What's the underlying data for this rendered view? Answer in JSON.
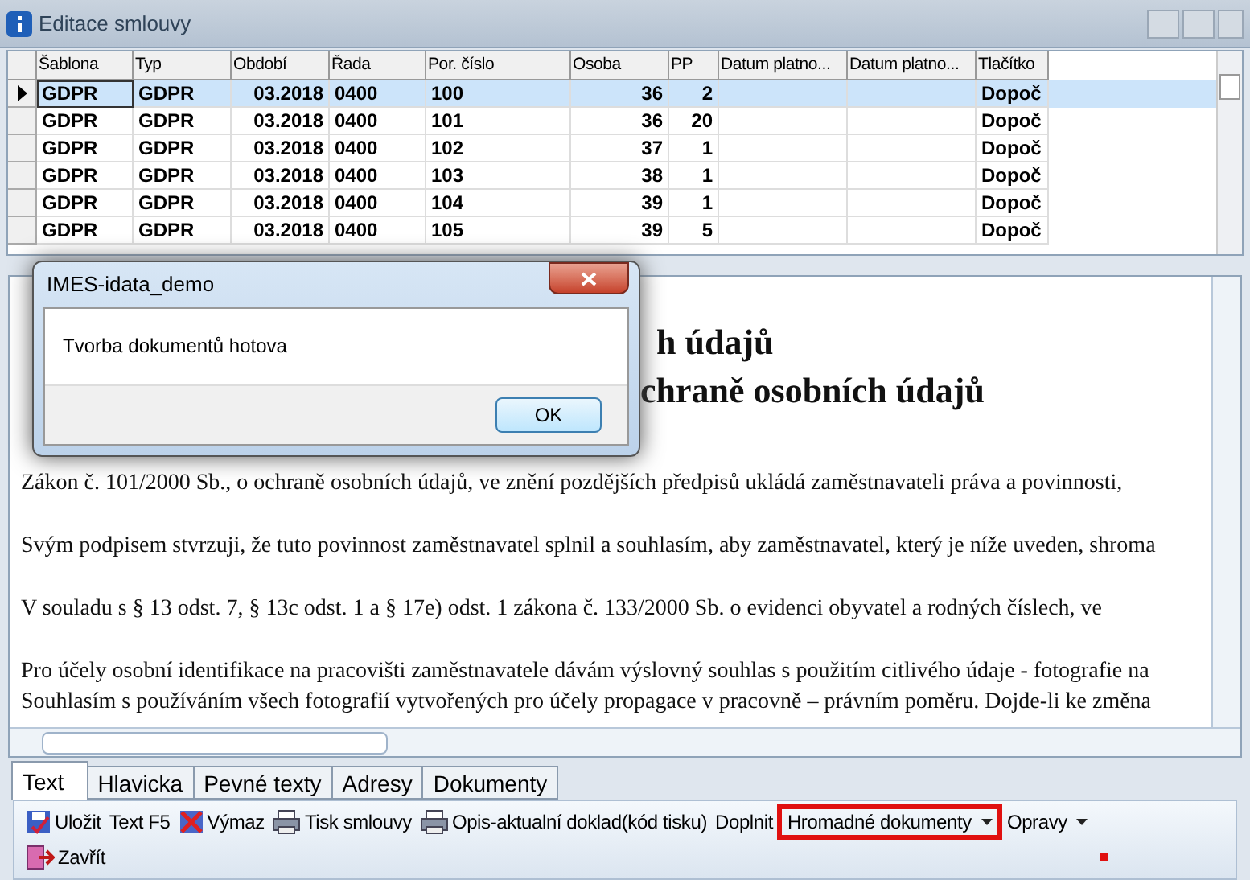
{
  "window": {
    "title": "Editace smlouvy"
  },
  "grid": {
    "columns": [
      "Šablona",
      "Typ",
      "Období",
      "Řada",
      "Por. číslo",
      "Osoba",
      "PP",
      "Datum platno...",
      "Datum platno...",
      "Tlačítko"
    ],
    "rows": [
      {
        "selected": true,
        "cells": [
          "GDPR",
          "GDPR",
          "03.2018",
          "0400",
          "100",
          "36",
          "2",
          "",
          "",
          "Dopoč"
        ]
      },
      {
        "selected": false,
        "cells": [
          "GDPR",
          "GDPR",
          "03.2018",
          "0400",
          "101",
          "36",
          "20",
          "",
          "",
          "Dopoč"
        ]
      },
      {
        "selected": false,
        "cells": [
          "GDPR",
          "GDPR",
          "03.2018",
          "0400",
          "102",
          "37",
          "1",
          "",
          "",
          "Dopoč"
        ]
      },
      {
        "selected": false,
        "cells": [
          "GDPR",
          "GDPR",
          "03.2018",
          "0400",
          "103",
          "38",
          "1",
          "",
          "",
          "Dopoč"
        ]
      },
      {
        "selected": false,
        "cells": [
          "GDPR",
          "GDPR",
          "03.2018",
          "0400",
          "104",
          "39",
          "1",
          "",
          "",
          "Dopoč"
        ]
      },
      {
        "selected": false,
        "cells": [
          "GDPR",
          "GDPR",
          "03.2018",
          "0400",
          "105",
          "39",
          "5",
          "",
          "",
          "Dopoč"
        ]
      }
    ]
  },
  "document": {
    "headings": [
      "h údajů",
      "chraně osobních údajů"
    ],
    "paragraphs": [
      [
        "Zákon č. 101/2000 Sb., o ochraně osobních údajů, ve znění pozdějších předpisů ukládá zaměstnavateli práva a povinnosti,"
      ],
      [
        "Svým podpisem stvrzuji, že tuto povinnost zaměstnavatel splnil a souhlasím, aby zaměstnavatel, který je níže uveden, shroma"
      ],
      [
        "V souladu s § 13 odst. 7, § 13c odst. 1 a § 17e) odst. 1 zákona č. 133/2000 Sb. o evidenci obyvatel a rodných číslech, ve"
      ],
      [
        "Pro účely osobní identifikace na pracovišti zaměstnavatele dávám výslovný souhlas s použitím citlivého údaje - fotografie na",
        "Souhlasím s používáním všech fotografií vytvořených pro účely propagace v pracovně – právním poměru. Dojde-li ke změna"
      ]
    ]
  },
  "dialog": {
    "title": "IMES-idata_demo",
    "message": "Tvorba dokumentů hotova",
    "button": "OK"
  },
  "tabs": [
    {
      "label": "Text",
      "selected": true
    },
    {
      "label": "Hlavicka",
      "selected": false
    },
    {
      "label": "Pevné texty",
      "selected": false
    },
    {
      "label": "Adresy",
      "selected": false
    },
    {
      "label": "Dokumenty",
      "selected": false
    }
  ],
  "toolbar": [
    {
      "kind": "save",
      "label": "Uložit",
      "highlighted": false
    },
    {
      "kind": "plain",
      "label": "Text F5",
      "highlighted": false
    },
    {
      "kind": "delete",
      "label": "Výmaz",
      "highlighted": false
    },
    {
      "kind": "print",
      "label": "Tisk smlouvy",
      "highlighted": false
    },
    {
      "kind": "print",
      "label": "Opis-aktualní doklad(kód tisku)",
      "highlighted": false
    },
    {
      "kind": "plain",
      "label": "Doplnit",
      "highlighted": false
    },
    {
      "kind": "dropdown",
      "label": "Hromadné dokumenty",
      "highlighted": true
    },
    {
      "kind": "dropdown",
      "label": "Opravy",
      "highlighted": false
    },
    {
      "kind": "exit",
      "label": "Zavřít",
      "highlighted": false
    }
  ]
}
